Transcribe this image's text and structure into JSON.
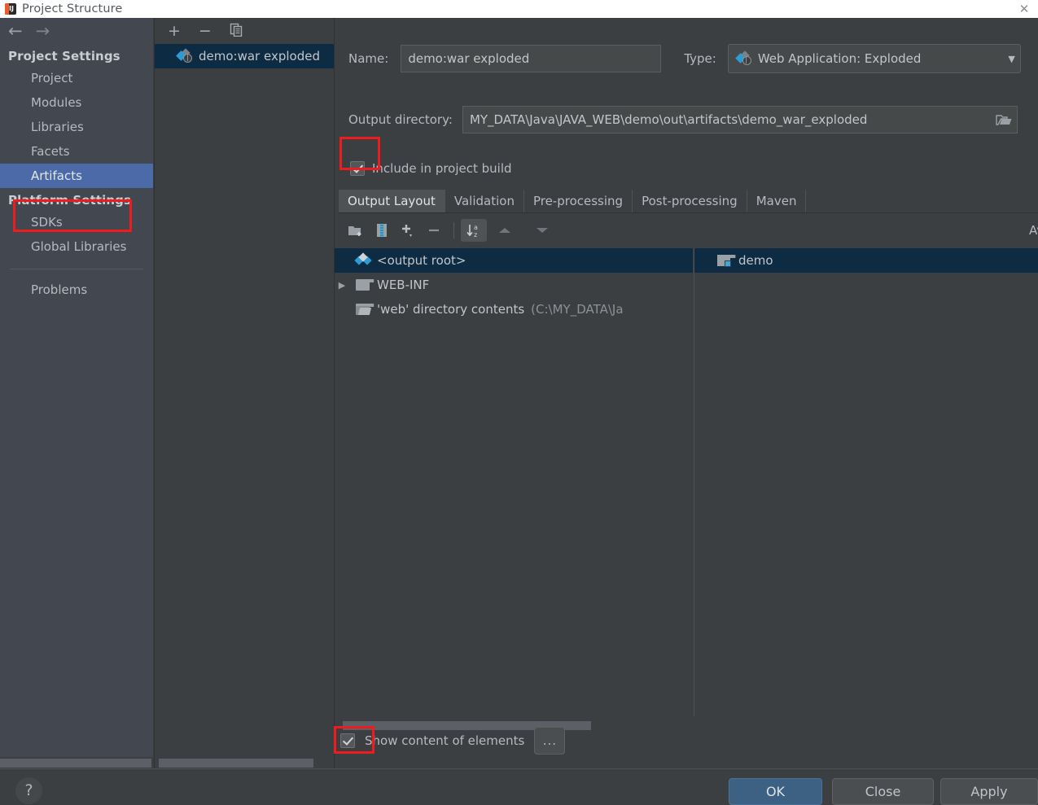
{
  "window": {
    "title": "Project Structure",
    "icon": "intellij-idea-icon",
    "close_label": "✕"
  },
  "sidebar": {
    "nav": {
      "back": "←",
      "forward": "→"
    },
    "sections": [
      {
        "header": "Project Settings",
        "items": [
          {
            "label": "Project",
            "selected": false
          },
          {
            "label": "Modules",
            "selected": false
          },
          {
            "label": "Libraries",
            "selected": false
          },
          {
            "label": "Facets",
            "selected": false
          },
          {
            "label": "Artifacts",
            "selected": true
          }
        ]
      },
      {
        "header": "Platform Settings",
        "items": [
          {
            "label": "SDKs",
            "selected": false
          },
          {
            "label": "Global Libraries",
            "selected": false
          }
        ]
      }
    ],
    "problems_label": "Problems"
  },
  "artifacts_panel": {
    "toolbar": {
      "add": "+",
      "remove": "−",
      "copy": "copy-icon"
    },
    "items": [
      {
        "label": "demo:war exploded",
        "icon": "artifact-icon",
        "selected": true
      }
    ]
  },
  "editor": {
    "name_label": "Name:",
    "name_value": "demo:war exploded",
    "type_label": "Type:",
    "type_value": "Web Application: Exploded",
    "output_dir_label": "Output directory:",
    "output_dir_value": "MY_DATA\\Java\\JAVA_WEB\\demo\\out\\artifacts\\demo_war_exploded",
    "include_in_build_label": "Include in project build",
    "include_in_build_checked": true,
    "tabs": [
      {
        "label": "Output Layout",
        "active": true
      },
      {
        "label": "Validation",
        "active": false
      },
      {
        "label": "Pre-processing",
        "active": false
      },
      {
        "label": "Post-processing",
        "active": false
      },
      {
        "label": "Maven",
        "active": false
      }
    ],
    "inner_toolbar": [
      {
        "name": "add-directory-icon",
        "glyph": "folder-plus"
      },
      {
        "name": "add-archive-icon",
        "glyph": "archive"
      },
      {
        "name": "add-element-icon",
        "glyph": "plus-dropdown"
      },
      {
        "name": "remove-element-icon",
        "glyph": "minus"
      },
      {
        "name": "sort-alphabetically-icon",
        "glyph": "sort-az"
      },
      {
        "name": "move-up-icon",
        "glyph": "up"
      },
      {
        "name": "move-down-icon",
        "glyph": "down"
      }
    ],
    "available_elements_label": "Available Elements",
    "output_tree": [
      {
        "label": "<output root>",
        "icon": "output-root-icon",
        "indent": 0,
        "selected": true,
        "expander": ""
      },
      {
        "label": "WEB-INF",
        "icon": "folder-icon",
        "indent": 0,
        "selected": false,
        "expander": "▶"
      },
      {
        "label": "'web' directory contents",
        "suffix": "(C:\\MY_DATA\\Ja",
        "icon": "folder-open-icon",
        "indent": 0,
        "selected": false,
        "expander": ""
      }
    ],
    "available_tree": [
      {
        "label": "demo",
        "icon": "module-icon",
        "selected": true
      }
    ],
    "show_content_label": "Show content of elements",
    "show_content_checked": true,
    "more_button_label": "..."
  },
  "footer": {
    "help_label": "?",
    "ok_label": "OK",
    "close_label": "Close",
    "apply_label": "Apply"
  },
  "colors": {
    "accent_blue": "#3c6183",
    "selection_blue": "#4c6aa8",
    "tree_selection": "#0d2b43",
    "annotation_red": "#ee1c1c",
    "panel_bg": "#3c3f41",
    "sidebar_bg": "#434750"
  }
}
